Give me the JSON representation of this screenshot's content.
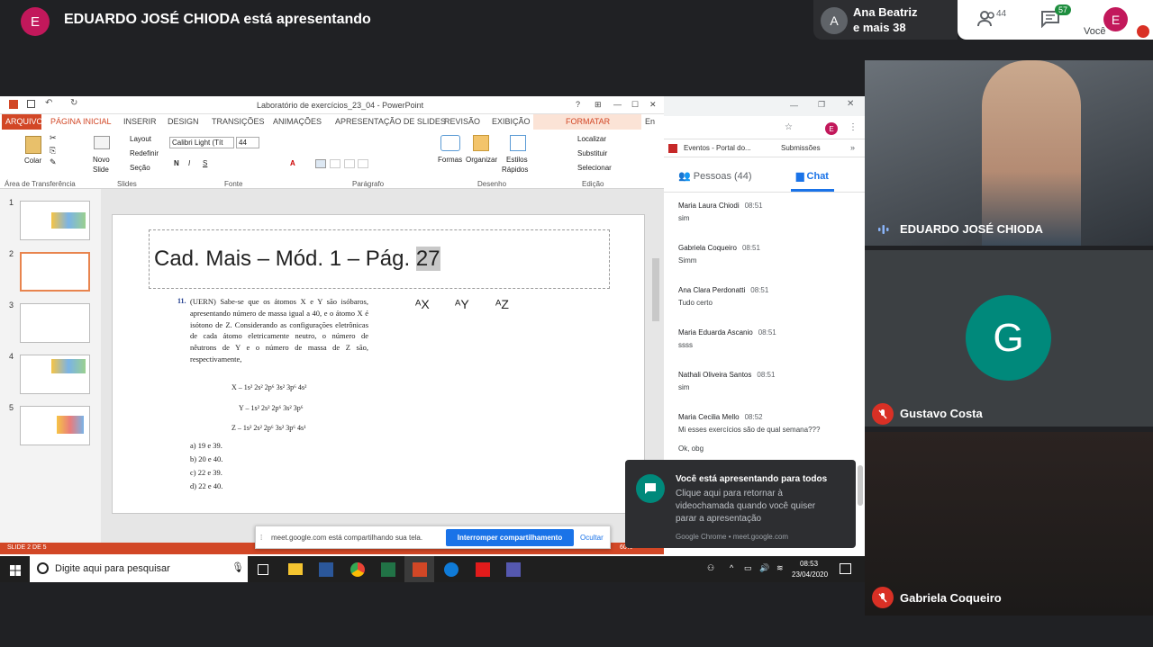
{
  "meet": {
    "presenter_initial": "E",
    "presenter_title": "EDUARDO JOSÉ CHIODA está apresentando",
    "people_initial": "A",
    "people_name": "Ana Beatriz",
    "people_more": "e mais 38",
    "participants_count": "44",
    "chat_count": "57",
    "self_initial": "E",
    "self_label": "Você"
  },
  "ppt": {
    "window_title": "Laboratório de exercícios_23_04 - PowerPoint",
    "title_controls": [
      "?",
      "⊞",
      "—",
      "☐",
      "✕"
    ],
    "tabs": [
      "ARQUIVO",
      "PÁGINA INICIAL",
      "INSERIR",
      "DESIGN",
      "TRANSIÇÕES",
      "ANIMAÇÕES",
      "APRESENTAÇÃO DE SLIDES",
      "REVISÃO",
      "EXIBIÇÃO",
      "FORMATAR",
      "En"
    ],
    "ribbon": {
      "paste": "Colar",
      "new_slide_1": "Novo",
      "new_slide_2": "Slide",
      "layout": "Layout",
      "reset": "Redefinir",
      "section": "Seção",
      "font_name": "Calibri Light (Tít",
      "font_size": "44",
      "shapes": "Formas",
      "arrange": "Organizar",
      "styles_1": "Estilos",
      "styles_2": "Rápidos",
      "find": "Localizar",
      "replace": "Substituir",
      "select": "Selecionar",
      "groups": [
        "Área de Transferência",
        "Slides",
        "Fonte",
        "Parágrafo",
        "Desenho",
        "Edição"
      ]
    },
    "thumb_numbers": [
      "1",
      "2",
      "3",
      "4",
      "5"
    ],
    "slide": {
      "title_text": "Cad. Mais – Mód. 1 – Pág. ",
      "title_page": "27",
      "question_number": "11.",
      "question_text": "(UERN) Sabe-se que os átomos X e Y são isóbaros, apresentando número de massa igual a 40, e o átomo X é isótono de Z. Considerando as configurações eletrônicas de cada átomo eletricamente neutro, o número de nêutrons de Y e o número de massa de Z são, respectivamente,",
      "notation": [
        "ᴬX",
        "ᴬY",
        "ᴬZ"
      ],
      "configs": [
        "X – 1s² 2s² 2p⁶ 3s² 3p⁶ 4s²",
        "Y – 1s² 2s² 2p⁶ 3s² 3p⁶",
        "Z – 1s² 2s² 2p⁶ 3s² 3p⁶ 4s¹"
      ],
      "options": [
        "a) 19 e 39.",
        "b) 20 e 40.",
        "c) 22 e 39.",
        "d) 22 e 40."
      ]
    },
    "status": "SLIDE 2 DE 5",
    "zoom": "60%"
  },
  "chrome": {
    "bookmark_1": "Eventos - Portal do...",
    "bookmark_2": "Submissões",
    "avatar": "E",
    "tab_people": "Pessoas (44)",
    "tab_chat": "Chat",
    "messages": [
      {
        "name": "Maria Laura Chiodi",
        "time": "08:51",
        "text": "sim"
      },
      {
        "name": "Gabriela Coqueiro",
        "time": "08:51",
        "text": "Simm"
      },
      {
        "name": "Ana Clara Perdonatti",
        "time": "08:51",
        "text": "Tudo certo"
      },
      {
        "name": "Maria Eduarda Ascanio",
        "time": "08:51",
        "text": "ssss"
      },
      {
        "name": "Nathali Oliveira Santos",
        "time": "08:51",
        "text": "sim"
      },
      {
        "name": "Maria Cecilia Mello",
        "time": "08:52",
        "text": "Mi esses exercícios são de qual semana???"
      },
      {
        "name": "",
        "time": "",
        "text": "Ok, obg"
      }
    ]
  },
  "toast": {
    "title": "Você está apresentando para todos",
    "body": "Clique aqui para retornar à videochamada quando você quiser parar a apresentação",
    "source": "Google Chrome • meet.google.com"
  },
  "share_banner": {
    "text": "meet.google.com está compartilhando sua tela.",
    "stop": "Interromper compartilhamento",
    "hide": "Ocultar"
  },
  "taskbar": {
    "search_placeholder": "Digite aqui para pesquisar",
    "time": "08:53",
    "date": "23/04/2020"
  },
  "tiles": [
    {
      "name": "EDUARDO JOSÉ CHIODA"
    },
    {
      "name": "Gustavo Costa",
      "initial": "G"
    },
    {
      "name": "Gabriela Coqueiro"
    }
  ]
}
